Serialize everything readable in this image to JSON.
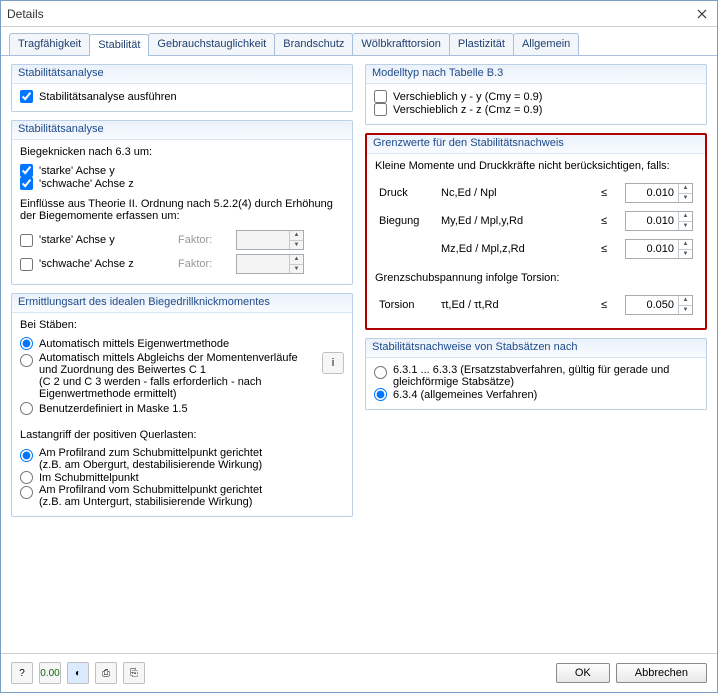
{
  "window": {
    "title": "Details"
  },
  "tabs": [
    "Tragfähigkeit",
    "Stabilität",
    "Gebrauchstauglichkeit",
    "Brandschutz",
    "Wölbkrafttorsion",
    "Plastizität",
    "Allgemein"
  ],
  "active_tab": 1,
  "left": {
    "g1": {
      "title": "Stabilitätsanalyse",
      "chk1": "Stabilitätsanalyse ausführen"
    },
    "g2": {
      "title": "Stabilitätsanalyse",
      "h1": "Biegeknicken nach 6.3 um:",
      "c1": "'starke' Achse y",
      "c2": "'schwache' Achse z",
      "h2": "Einflüsse aus Theorie II. Ordnung nach 5.2.2(4) durch Erhöhung der Biegemomente erfassen um:",
      "c3": "'starke' Achse y",
      "c4": "'schwache' Achse z",
      "faktor": "Faktor:"
    },
    "g3": {
      "title": "Ermittlungsart des idealen Biegedrillknickmomentes",
      "h1": "Bei Stäben:",
      "r1": "Automatisch mittels Eigenwertmethode",
      "r2": "Automatisch mittels Abgleichs der Momentenverläufe und Zuordnung des Beiwertes C 1",
      "r2b": "(C 2 und C 3 werden - falls erforderlich - nach Eigenwertmethode ermittelt)",
      "r3": "Benutzerdefiniert in Maske 1.5",
      "h2": "Lastangriff der positiven Querlasten:",
      "r4": "Am Profilrand zum Schubmittelpunkt gerichtet",
      "r4b": "(z.B. am Obergurt, destabilisierende Wirkung)",
      "r5": "Im Schubmittelpunkt",
      "r6": "Am Profilrand vom Schubmittelpunkt gerichtet",
      "r6b": "(z.B. am Untergurt, stabilisierende Wirkung)"
    }
  },
  "right": {
    "g1": {
      "title": "Modelltyp nach Tabelle B.3",
      "c1": "Verschieblich y - y (Cmy = 0.9)",
      "c2": "Verschieblich z - z (Cmz = 0.9)"
    },
    "g2": {
      "title": "Grenzwerte für den Stabilitätsnachweis",
      "note": "Kleine Momente und Druckkräfte nicht berücksichtigen, falls:",
      "rows": [
        {
          "lbl": "Druck",
          "sym": "Nc,Ed / Npl",
          "le": "≤",
          "val": "0.010"
        },
        {
          "lbl": "Biegung",
          "sym": "My,Ed / Mpl,y,Rd",
          "le": "≤",
          "val": "0.010"
        },
        {
          "lbl": "",
          "sym": "Mz,Ed / Mpl,z,Rd",
          "le": "≤",
          "val": "0.010"
        }
      ],
      "note2": "Grenzschubspannung infolge Torsion:",
      "row4": {
        "lbl": "Torsion",
        "sym": "τt,Ed / τt,Rd",
        "le": "≤",
        "val": "0.050"
      }
    },
    "g3": {
      "title": "Stabilitätsnachweise von Stabsätzen nach",
      "r1": "6.3.1 ... 6.3.3   (Ersatzstabverfahren, gültig für gerade und gleichförmige Stabsätze)",
      "r2": "6.3.4 (allgemeines Verfahren)"
    }
  },
  "footer": {
    "ok": "OK",
    "cancel": "Abbrechen",
    "icon_labels": [
      "?",
      "0.00",
      "◐",
      "⎙",
      "⎘"
    ]
  }
}
